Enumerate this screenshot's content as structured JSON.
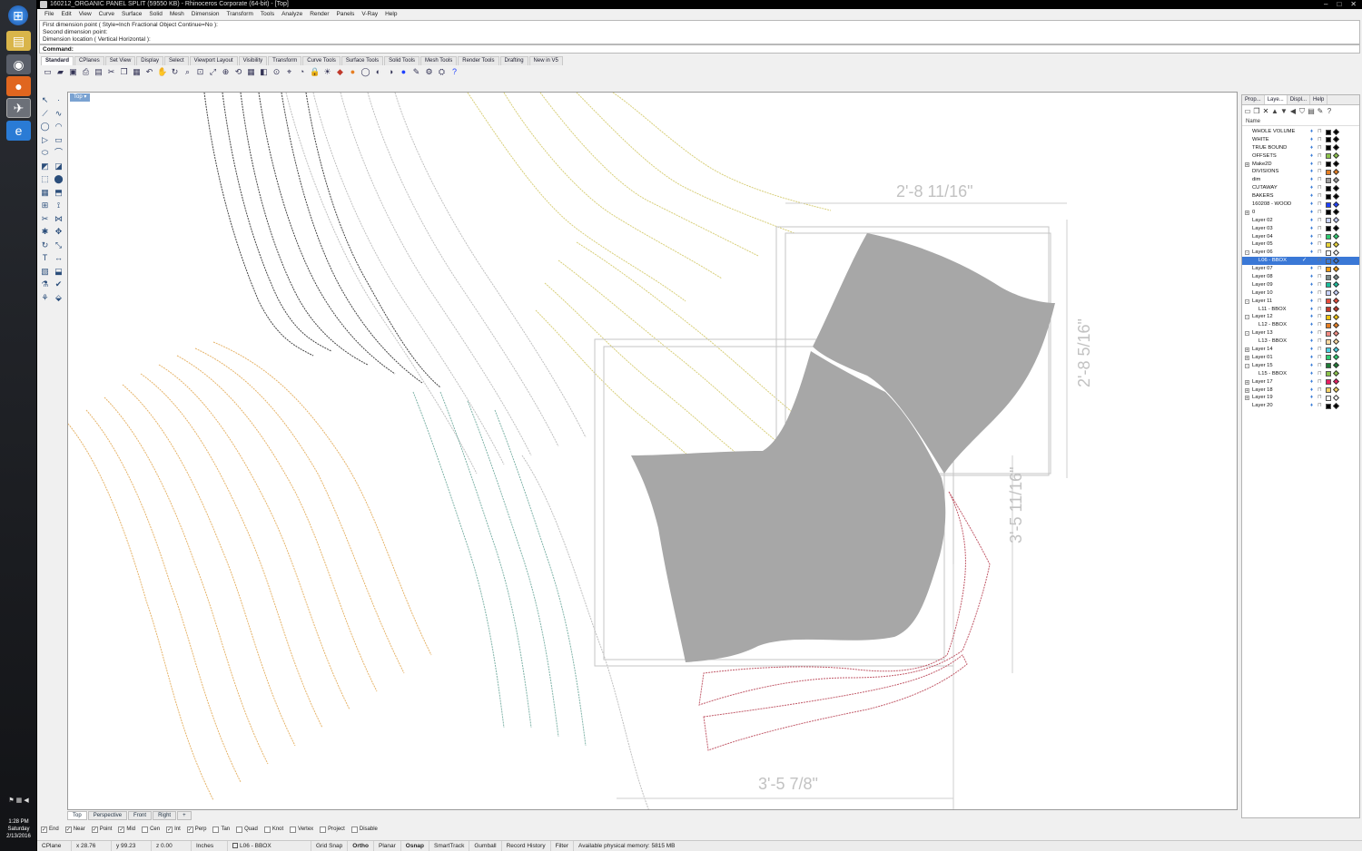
{
  "window": {
    "title": "160212_ORGANIC PANEL SPLIT (59550 KB) - Rhinoceros Corporate (64-bit) - [Top]",
    "controls": [
      "–",
      "□",
      "✕"
    ]
  },
  "taskbar": {
    "clock_time": "1:28 PM",
    "clock_day": "Saturday",
    "clock_date": "2/13/2016"
  },
  "menu": [
    "File",
    "Edit",
    "View",
    "Curve",
    "Surface",
    "Solid",
    "Mesh",
    "Dimension",
    "Transform",
    "Tools",
    "Analyze",
    "Render",
    "Panels",
    "V-Ray",
    "Help"
  ],
  "command_history": [
    "First dimension point ( Style=Inch Fractional  Object  Continue=No ):",
    "Second dimension point:",
    "Dimension location ( Vertical  Horizontal ):"
  ],
  "command_prompt": "Command:",
  "toolbar_tabs": [
    "Standard",
    "CPlanes",
    "Set View",
    "Display",
    "Select",
    "Viewport Layout",
    "Visibility",
    "Transform",
    "Curve Tools",
    "Surface Tools",
    "Solid Tools",
    "Mesh Tools",
    "Render Tools",
    "Drafting",
    "New in V5"
  ],
  "viewport": {
    "label": "Top",
    "dimensions": {
      "top_width": "2'-8 11/16\"",
      "right_height": "2'-8 5/16\"",
      "mid_height": "3'-5 11/16\"",
      "bottom_width": "3'-5 7/8\""
    }
  },
  "viewport_tabs": [
    "Top",
    "Perspective",
    "Front",
    "Right"
  ],
  "viewport_tab_add": "+",
  "osnaps": [
    {
      "label": "End",
      "checked": true
    },
    {
      "label": "Near",
      "checked": true
    },
    {
      "label": "Point",
      "checked": true
    },
    {
      "label": "Mid",
      "checked": true
    },
    {
      "label": "Cen",
      "checked": false
    },
    {
      "label": "Int",
      "checked": true
    },
    {
      "label": "Perp",
      "checked": true
    },
    {
      "label": "Tan",
      "checked": false
    },
    {
      "label": "Quad",
      "checked": false
    },
    {
      "label": "Knot",
      "checked": false
    },
    {
      "label": "Vertex",
      "checked": false
    },
    {
      "label": "Project",
      "checked": false
    },
    {
      "label": "Disable",
      "checked": false
    }
  ],
  "status": {
    "cplane": "CPlane",
    "x": "x 28.76",
    "y": "y 99.23",
    "z": "z 0.00",
    "units": "Inches",
    "layer": "L06 - BBOX",
    "grid_snap": "Grid Snap",
    "ortho": "Ortho",
    "planar": "Planar",
    "osnap": "Osnap",
    "smarttrack": "SmartTrack",
    "gumball": "Gumball",
    "record_history": "Record History",
    "filter": "Filter",
    "memory": "Available physical memory: 5815 MB"
  },
  "panel_tabs": [
    "Prop...",
    "Laye...",
    "Displ...",
    "Help"
  ],
  "layer_header": "Name",
  "layers": [
    {
      "name": "WHOLE VOLUME",
      "color": "#000000",
      "exp": "",
      "child": false
    },
    {
      "name": "WHITE",
      "color": "#000000",
      "exp": "",
      "child": false
    },
    {
      "name": "TRUE BOUND",
      "color": "#000000",
      "exp": "",
      "child": false
    },
    {
      "name": "OFFSETS",
      "color": "#8bc34a",
      "exp": "",
      "child": false
    },
    {
      "name": "Make2D",
      "color": "#000000",
      "exp": "+",
      "child": false
    },
    {
      "name": "DIVISIONS",
      "color": "#e67e22",
      "exp": "",
      "child": false
    },
    {
      "name": "dim",
      "color": "#9e9e9e",
      "exp": "",
      "child": false
    },
    {
      "name": "CUTAWAY",
      "color": "#000000",
      "exp": "",
      "child": false
    },
    {
      "name": "BAKERS",
      "color": "#000000",
      "exp": "",
      "child": false
    },
    {
      "name": "160208 - WOOD",
      "color": "#1e40ff",
      "exp": "",
      "child": false
    },
    {
      "name": "0",
      "color": "#000000",
      "exp": "+",
      "child": false
    },
    {
      "name": "Layer 02",
      "color": "#c7d2fe",
      "exp": "",
      "child": false
    },
    {
      "name": "Layer 03",
      "color": "#000000",
      "exp": "",
      "child": false
    },
    {
      "name": "Layer 04",
      "color": "#2ecc71",
      "exp": "",
      "child": false
    },
    {
      "name": "Layer 05",
      "color": "#e6d23a",
      "exp": "",
      "child": false
    },
    {
      "name": "Layer 06",
      "color": "#ffffff",
      "exp": "-",
      "child": false
    },
    {
      "name": "L06 - BBOX",
      "color": "#3a78d6",
      "exp": "",
      "child": true,
      "selected": true
    },
    {
      "name": "Layer 07",
      "color": "#f39c12",
      "exp": "",
      "child": false
    },
    {
      "name": "Layer 08",
      "color": "#7f8c8d",
      "exp": "",
      "child": false
    },
    {
      "name": "Layer 09",
      "color": "#1abc9c",
      "exp": "",
      "child": false
    },
    {
      "name": "Layer 10",
      "color": "#c7d2fe",
      "exp": "",
      "child": false
    },
    {
      "name": "Layer 11",
      "color": "#e74c3c",
      "exp": "-",
      "child": false
    },
    {
      "name": "L11 - BBOX",
      "color": "#c0392b",
      "exp": "",
      "child": true
    },
    {
      "name": "Layer 12",
      "color": "#f1c40f",
      "exp": "-",
      "child": false
    },
    {
      "name": "L12 - BBOX",
      "color": "#e67e22",
      "exp": "",
      "child": true
    },
    {
      "name": "Layer 13",
      "color": "#f28b82",
      "exp": "-",
      "child": false
    },
    {
      "name": "L13 - BBOX",
      "color": "#fdd9a0",
      "exp": "",
      "child": true
    },
    {
      "name": "Layer 14",
      "color": "#4dd0e1",
      "exp": "+",
      "child": false
    },
    {
      "name": "Layer 01",
      "color": "#2ecc71",
      "exp": "+",
      "child": false
    },
    {
      "name": "Layer 15",
      "color": "#1e7a34",
      "exp": "-",
      "child": false
    },
    {
      "name": "L15 - BBOX",
      "color": "#8bc34a",
      "exp": "",
      "child": true
    },
    {
      "name": "Layer 17",
      "color": "#e91e63",
      "exp": "+",
      "child": false
    },
    {
      "name": "Layer 18",
      "color": "#f6d365",
      "exp": "+",
      "child": false
    },
    {
      "name": "Layer 19",
      "color": "#ffffff",
      "exp": "+",
      "child": false
    },
    {
      "name": "Layer 20",
      "color": "#000000",
      "exp": "",
      "child": false
    }
  ]
}
